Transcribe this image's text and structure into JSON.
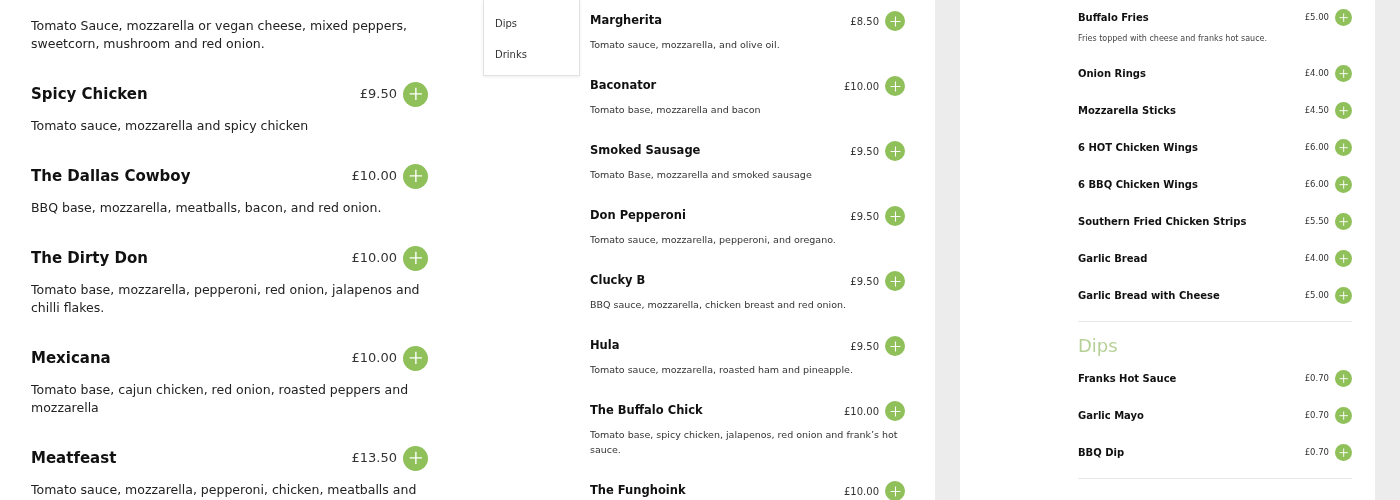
{
  "left_column": {
    "items": [
      {
        "description": "Tomato Sauce, mozzarella or vegan cheese, mixed peppers, sweetcorn, mushroom and red onion."
      },
      {
        "name": "Spicy Chicken",
        "price": "£9.50",
        "description": "Tomato sauce, mozzarella and spicy chicken"
      },
      {
        "name": "The Dallas Cowboy",
        "price": "£10.00",
        "description": "BBQ base, mozzarella, meatballs, bacon, and red onion."
      },
      {
        "name": "The Dirty Don",
        "price": "£10.00",
        "description": "Tomato base, mozzarella, pepperoni, red onion, jalapenos and chilli flakes."
      },
      {
        "name": "Mexicana",
        "price": "£10.00",
        "description": "Tomato base, cajun chicken, red onion, roasted peppers and mozzarella"
      },
      {
        "name": "Meatfeast",
        "price": "£13.50",
        "description": "Tomato sauce, mozzarella, pepperoni, chicken, meatballs and"
      }
    ]
  },
  "category_nav": {
    "items": [
      {
        "label": "Dips"
      },
      {
        "label": "Drinks"
      }
    ]
  },
  "middle_column": {
    "items": [
      {
        "name": "Margherita",
        "price": "£8.50",
        "description": "Tomato sauce, mozzarella, and olive oil."
      },
      {
        "name": "Baconator",
        "price": "£10.00",
        "description": "Tomato base, mozzarella and bacon"
      },
      {
        "name": "Smoked Sausage",
        "price": "£9.50",
        "description": "Tomato Base, mozzarella and smoked sausage"
      },
      {
        "name": "Don Pepperoni",
        "price": "£9.50",
        "description": "Tomato sauce, mozzarella, pepperoni, and oregano."
      },
      {
        "name": "Clucky B",
        "price": "£9.50",
        "description": "BBQ sauce, mozzarella, chicken breast and red onion."
      },
      {
        "name": "Hula",
        "price": "£9.50",
        "description": "Tomato sauce, mozzarella, roasted ham and pineapple."
      },
      {
        "name": "The Buffalo Chick",
        "price": "£10.00",
        "description": "Tomato base, spicy chicken, jalapenos, red onion and frank’s hot sauce."
      },
      {
        "name": "The Funghoink",
        "price": "£10.00"
      }
    ]
  },
  "right_column": {
    "sections": [
      {
        "items": [
          {
            "name": "Buffalo Fries",
            "price": "£5.00",
            "description": "Fries topped with cheese and franks hot sauce."
          },
          {
            "name": "Onion Rings",
            "price": "£4.00"
          },
          {
            "name": "Mozzarella Sticks",
            "price": "£4.50"
          },
          {
            "name": "6 HOT Chicken Wings",
            "price": "£6.00"
          },
          {
            "name": "6 BBQ Chicken Wings",
            "price": "£6.00"
          },
          {
            "name": "Southern Fried Chicken Strips",
            "price": "£5.50"
          },
          {
            "name": "Garlic Bread",
            "price": "£4.00"
          },
          {
            "name": "Garlic Bread with Cheese",
            "price": "£5.00"
          }
        ]
      },
      {
        "heading": "Dips",
        "items": [
          {
            "name": "Franks Hot Sauce",
            "price": "£0.70"
          },
          {
            "name": "Garlic Mayo",
            "price": "£0.70"
          },
          {
            "name": "BBQ Dip",
            "price": "£0.70"
          }
        ]
      }
    ]
  }
}
